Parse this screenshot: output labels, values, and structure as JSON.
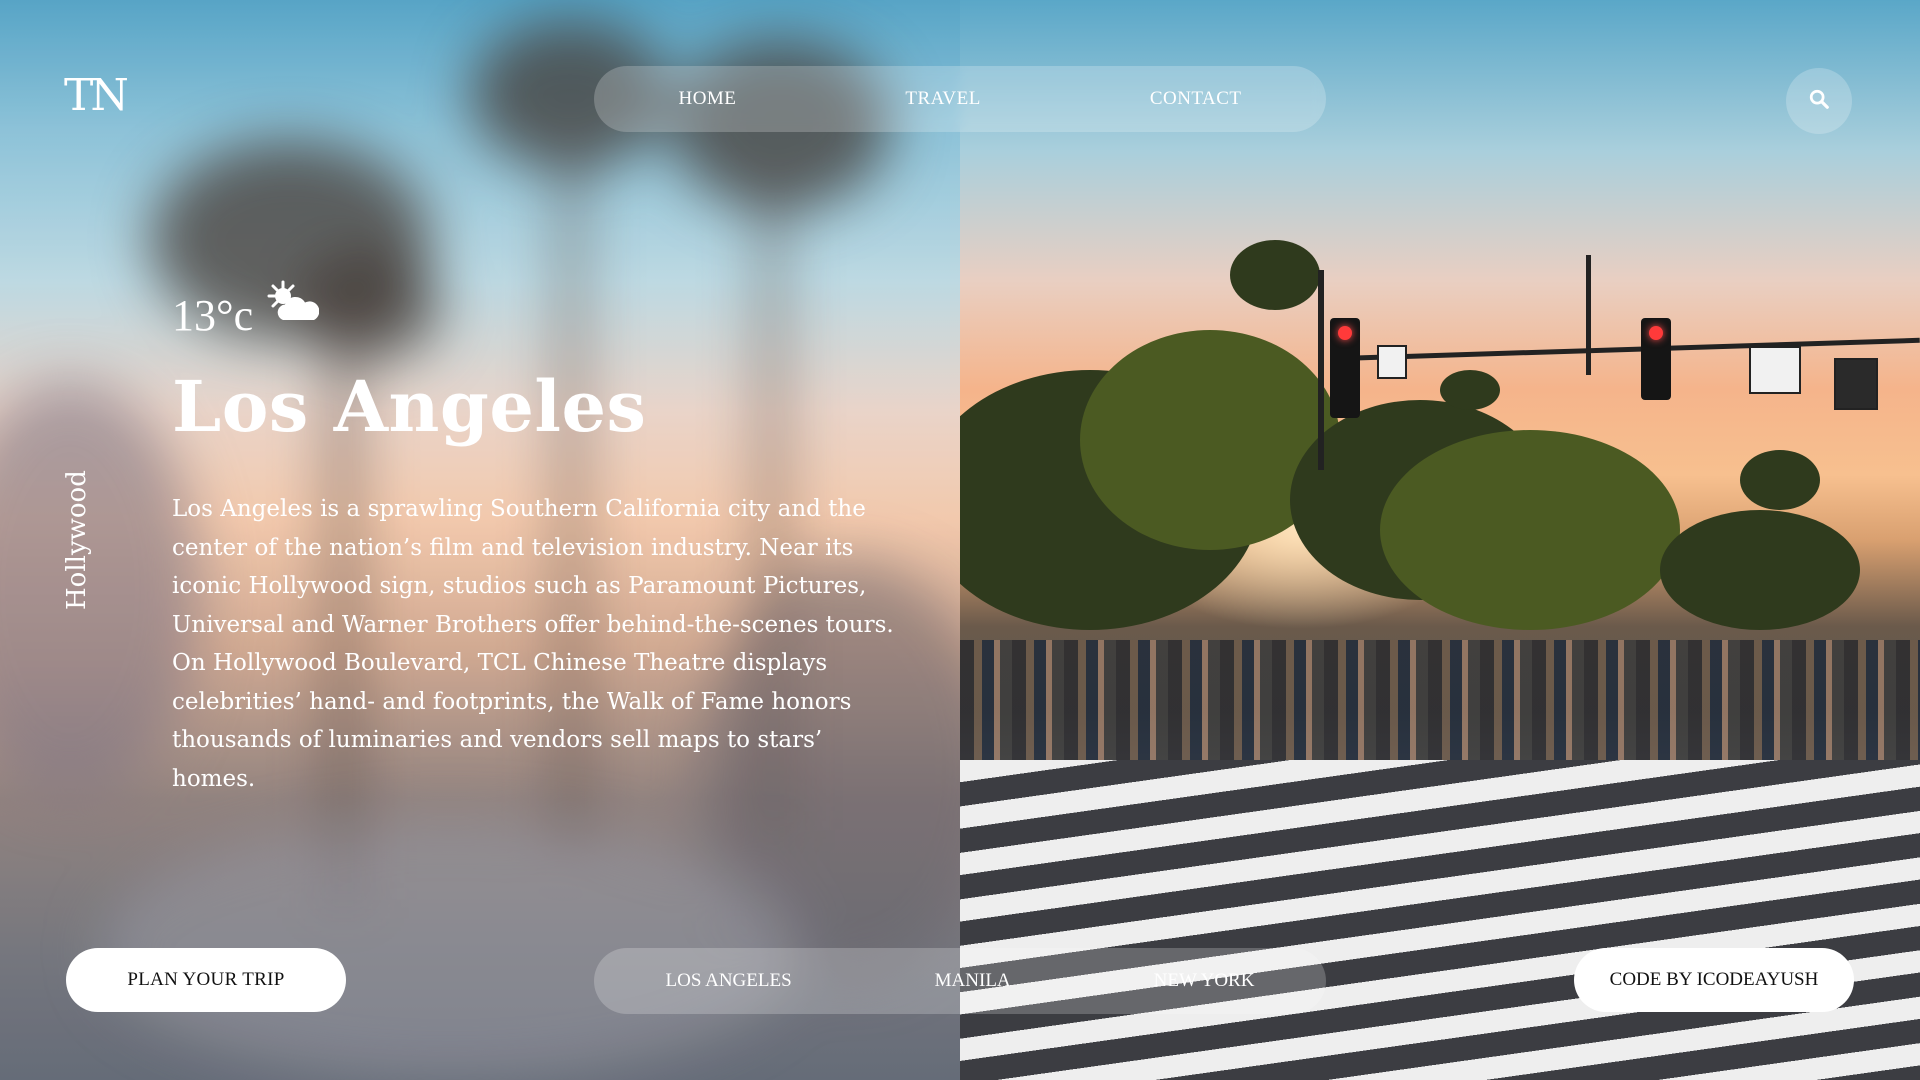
{
  "brand": {
    "logo_text": "TN"
  },
  "nav": {
    "items": [
      {
        "label": "HOME"
      },
      {
        "label": "TRAVEL"
      },
      {
        "label": "CONTACT"
      }
    ]
  },
  "search": {
    "icon": "search-icon"
  },
  "weather": {
    "temperature": "13°c",
    "icon": "sun-behind-cloud-icon"
  },
  "side_label": "Hollywood",
  "hero": {
    "title": "Los Angeles",
    "description": "Los Angeles is a sprawling Southern California city and the center of the nation’s film and television industry. Near its iconic Hollywood sign, studios such as Paramount Pictures, Universal and Warner Brothers offer behind-the-scenes tours. On Hollywood Boulevard, TCL Chinese Theatre displays celebrities’ hand- and footprints, the Walk of Fame honors thousands of luminaries and vendors sell maps to stars’ homes."
  },
  "cta": {
    "label": "PLAN YOUR TRIP"
  },
  "cities": {
    "items": [
      {
        "label": "LOS ANGELES"
      },
      {
        "label": "MANILA"
      },
      {
        "label": "NEW YORK"
      }
    ]
  },
  "credit": {
    "label": "CODE BY ICODEAYUSH"
  },
  "colors": {
    "button_bg": "#ffffff",
    "button_text": "#111111",
    "glass": "rgba(255,255,255,0.22)"
  }
}
